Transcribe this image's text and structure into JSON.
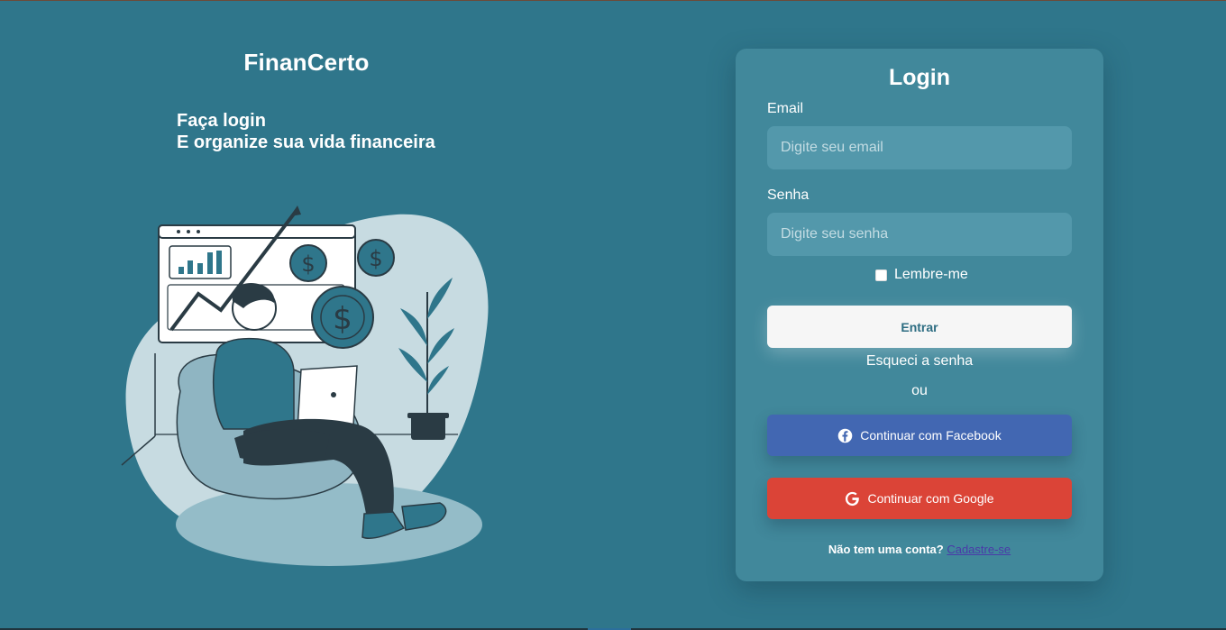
{
  "brand": {
    "name": "FinanCerto",
    "tagline_line1": "Faça login",
    "tagline_line2": "E organize sua vida financeira"
  },
  "illustration": {
    "icon": "finance-illustration"
  },
  "login": {
    "title": "Login",
    "email_label": "Email",
    "email_placeholder": "Digite seu email",
    "email_value": "",
    "password_label": "Senha",
    "password_placeholder": "Digite seu senha",
    "password_value": "",
    "remember_label": "Lembre-me",
    "remember_checked": false,
    "submit_label": "Entrar",
    "forgot_label": "Esqueci a senha",
    "or_label": "ou",
    "facebook_label": "Continuar com Facebook",
    "google_label": "Continuar com Google",
    "no_account_text": "Não tem uma conta?",
    "signup_label": "Cadastre-se"
  },
  "colors": {
    "background": "#2f768b",
    "card": "#41889b",
    "input": "#5398ab",
    "facebook": "#4267b2",
    "google": "#db4437",
    "link": "#4a3aa8"
  }
}
